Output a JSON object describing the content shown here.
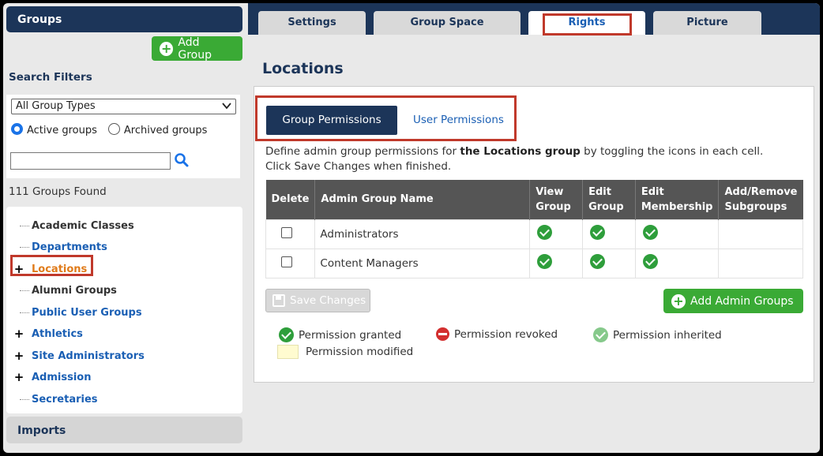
{
  "sidebar": {
    "title": "Groups",
    "add_group_label": "Add Group",
    "filters_title": "Search Filters",
    "group_type_value": "All Group Types",
    "radio_active": "Active groups",
    "radio_archived": "Archived groups",
    "search_value": "",
    "found_text": "111 Groups Found",
    "tree": [
      {
        "label": "Academic Classes",
        "marker": "dash",
        "style": "dark"
      },
      {
        "label": "Departments",
        "marker": "dash",
        "style": "link"
      },
      {
        "label": "Locations",
        "marker": "+",
        "style": "active"
      },
      {
        "label": "Alumni Groups",
        "marker": "dash",
        "style": "dark"
      },
      {
        "label": "Public User Groups",
        "marker": "dash",
        "style": "link"
      },
      {
        "label": "Athletics",
        "marker": "+",
        "style": "link"
      },
      {
        "label": "Site Administrators",
        "marker": "+",
        "style": "link"
      },
      {
        "label": "Admission",
        "marker": "+",
        "style": "link"
      },
      {
        "label": "Secretaries",
        "marker": "dash",
        "style": "link"
      }
    ],
    "imports_label": "Imports"
  },
  "tabs": [
    {
      "label": "Settings",
      "selected": false
    },
    {
      "label": "Group Space",
      "selected": false
    },
    {
      "label": "Rights",
      "selected": true
    },
    {
      "label": "Picture",
      "selected": false
    }
  ],
  "page_title": "Locations",
  "sub_tabs": {
    "active": "Group Permissions",
    "other": "User Permissions"
  },
  "description": {
    "part1": "Define admin group permissions for ",
    "bold": "the Locations group",
    "part2": " by toggling the icons in each cell. Click Save Changes when finished."
  },
  "table": {
    "headers": {
      "delete": "Delete",
      "name": "Admin Group Name",
      "view1": "View",
      "view2": "Group",
      "edit1": "Edit",
      "edit2": "Group",
      "mem1": "Edit",
      "mem2": "Membership",
      "sub1": "Add/Remove",
      "sub2": "Subgroups"
    },
    "rows": [
      {
        "name": "Administrators",
        "view_group": "granted",
        "edit_group": "granted",
        "edit_membership": "granted",
        "add_remove_subgroups": ""
      },
      {
        "name": "Content Managers",
        "view_group": "granted",
        "edit_group": "granted",
        "edit_membership": "granted",
        "add_remove_subgroups": ""
      }
    ]
  },
  "save_label": "Save Changes",
  "add_admin_label": "Add Admin Groups",
  "legend": {
    "granted": "Permission granted",
    "revoked": "Permission revoked",
    "inherited": "Permission inherited",
    "modified": "Permission modified"
  },
  "colors": {
    "navy": "#1c3559",
    "green": "#3aaa35",
    "highlight_red": "#c0392b",
    "link_blue": "#1a5fb4",
    "active_orange": "#e07b1a"
  }
}
